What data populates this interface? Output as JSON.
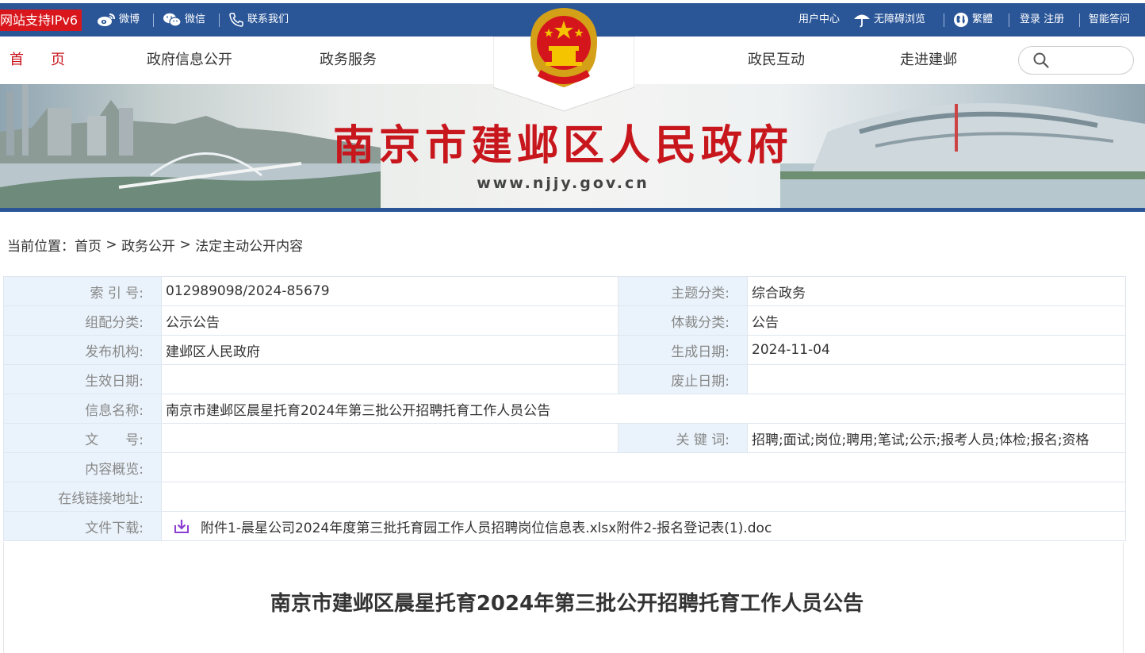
{
  "topbar": {
    "ipv6": "网站支持IPv6",
    "weibo": "微博",
    "weixin": "微信",
    "contact": "联系我们",
    "user_center": "用户中心",
    "accessibility": "无障碍浏览",
    "traditional": "繁體",
    "login_register": "登录 注册",
    "smart_qa": "智能答问"
  },
  "nav": {
    "home": "首页",
    "gov_info": "政府信息公开",
    "gov_service": "政务服务",
    "interaction": "政民互动",
    "about": "走进建邺"
  },
  "search": {
    "placeholder": ""
  },
  "banner": {
    "title": "南京市建邺区人民政府",
    "url": "www.njjy.gov.cn"
  },
  "breadcrumb": {
    "prefix": "当前位置：",
    "home": "首页",
    "sep": " > ",
    "level1": "政务公开",
    "level2": "法定主动公开内容"
  },
  "meta": {
    "index_label": "索 引 号:",
    "index_value": "012989098/2024-85679",
    "topic_label": "主题分类:",
    "topic_value": "综合政务",
    "org_label": "组配分类:",
    "org_value": "公示公告",
    "genre_label": "体裁分类:",
    "genre_value": "公告",
    "publisher_label": "发布机构:",
    "publisher_value": "建邺区人民政府",
    "created_label": "生成日期:",
    "created_value": "2024-11-04",
    "effective_label": "生效日期:",
    "effective_value": "",
    "abolish_label": "废止日期:",
    "abolish_value": "",
    "name_label": "信息名称:",
    "name_value": "南京市建邺区晨星托育2024年第三批公开招聘托育工作人员公告",
    "docno_label": "文　　号:",
    "docno_value": "",
    "keywords_label": "关 键 词:",
    "keywords_value": "招聘;面试;岗位;聘用;笔试;公示;报考人员;体检;报名;资格",
    "summary_label": "内容概览:",
    "summary_value": "",
    "link_label": "在线链接地址:",
    "link_value": "",
    "download_label": "文件下载:",
    "download_value": "附件1-晨星公司2024年度第三批托育园工作人员招聘岗位信息表.xlsx附件2-报名登记表(1).doc"
  },
  "article": {
    "title": "南京市建邺区晨星托育2024年第三批公开招聘托育工作人员公告"
  }
}
